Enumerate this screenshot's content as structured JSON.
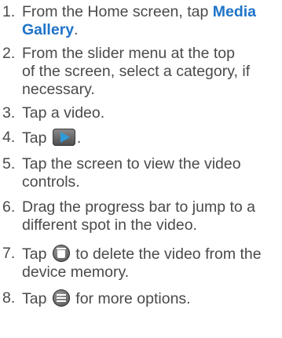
{
  "steps": [
    {
      "number": "1.",
      "line1_pre": "From the Home screen, tap ",
      "line1_link": "Media",
      "line2_link": "Gallery",
      "line2_post": "."
    },
    {
      "number": "2.",
      "line1": "From the slider menu at the top",
      "line2": "of the screen, select a category, if",
      "line3": "necessary."
    },
    {
      "number": "3.",
      "line1": "Tap a video."
    },
    {
      "number": "4.",
      "pre": "Tap ",
      "post": ".",
      "icon": "play-icon"
    },
    {
      "number": "5.",
      "line1": "Tap the screen to view the video",
      "line2": "controls."
    },
    {
      "number": "6.",
      "line1": "Drag the progress bar to jump to a",
      "line2": "different spot in the video."
    },
    {
      "number": "7.",
      "pre": "Tap ",
      "post": " to delete the video from the",
      "line2": "device memory.",
      "icon": "trash-icon"
    },
    {
      "number": "8.",
      "pre": "Tap ",
      "post": " for more options.",
      "icon": "menu-icon"
    }
  ],
  "colors": {
    "text": "#4a4a4a",
    "link": "#1e73c8"
  }
}
